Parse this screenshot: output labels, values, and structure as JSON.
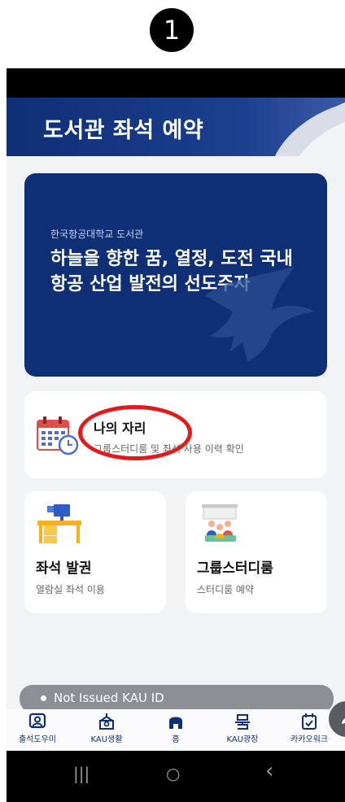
{
  "step_number": "1",
  "header": {
    "title": "도서관 좌석 예약"
  },
  "banner": {
    "subtitle": "한국항공대학교 도서관",
    "title": "하늘을 향한 꿈, 열정, 도전 국내 항공 산업 발전의 선도주자"
  },
  "my_seat_card": {
    "title": "나의 자리",
    "description": "그룹스터디룸 및 좌석 사용 이력 확인"
  },
  "tiles": [
    {
      "title": "좌석 발권",
      "description": "열람실 좌석 이용"
    },
    {
      "title": "그룹스터디룸",
      "description": "스터디룸 예약"
    }
  ],
  "kau_strip": {
    "text": "Not Issued KAU ID"
  },
  "bottom_nav": [
    {
      "label": "출석도우미",
      "icon": "attendance-icon"
    },
    {
      "label": "KAU생활",
      "icon": "campus-life-icon"
    },
    {
      "label": "홈",
      "icon": "home-icon"
    },
    {
      "label": "KAU광장",
      "icon": "plaza-icon"
    },
    {
      "label": "카카오워크",
      "icon": "kakaowork-icon"
    }
  ],
  "system_nav": {
    "recent": "|||",
    "home": "○",
    "back": "‹"
  },
  "colors": {
    "navy": "#0e2f75",
    "highlight": "#e41a1a",
    "background": "#f2f3f5"
  }
}
